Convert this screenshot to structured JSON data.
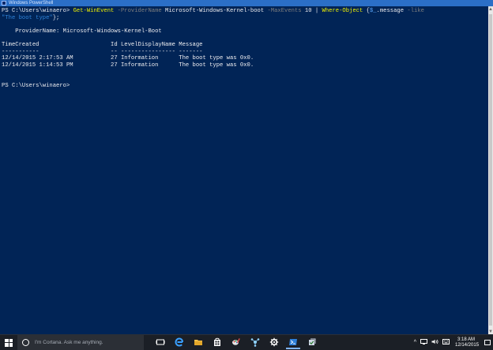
{
  "window": {
    "title": "Windows PowerShell"
  },
  "console": {
    "line1": {
      "prompt": "PS C:\\Users\\winaero> ",
      "cmd1": "Get-WinEvent",
      "param1": " -ProviderName ",
      "arg1": "Microsoft-Windows-Kernel-boot",
      "param2": " -MaxEvents ",
      "arg2": "10",
      "pipe": " | ",
      "cmd2": "Where-Object",
      "brace_open": " {",
      "var": "$_",
      "member": ".message",
      "param3": " -like"
    },
    "line2": {
      "str": "\"The boot type\"",
      "tail": "};"
    },
    "provider_line": "    ProviderName: Microsoft-Windows-Kernel-Boot",
    "headers": "TimeCreated                     Id LevelDisplayName Message",
    "dashes": "-----------                     -- ---------------- -------",
    "rows": [
      "12/14/2015 2:17:53 AM           27 Information      The boot type was 0x0.",
      "12/14/2015 1:14:53 PM           27 Information      The boot type was 0x0."
    ],
    "prompt2": "PS C:\\Users\\winaero>"
  },
  "taskbar": {
    "search_placeholder": "I'm Cortana. Ask me anything.",
    "icons": [
      "task-view-icon",
      "edge-icon",
      "file-explorer-icon",
      "store-icon",
      "paint-icon",
      "network-icon",
      "settings-icon",
      "powershell-icon",
      "app-icon"
    ],
    "tray_chevron": "^",
    "time": "3:18 AM",
    "date": "12/14/2015"
  },
  "colors": {
    "console_bg": "#012456",
    "cmdlet": "#f2f200",
    "parameter": "#7f7f7f",
    "string": "#2f83d9",
    "variable": "#58a6ff"
  }
}
